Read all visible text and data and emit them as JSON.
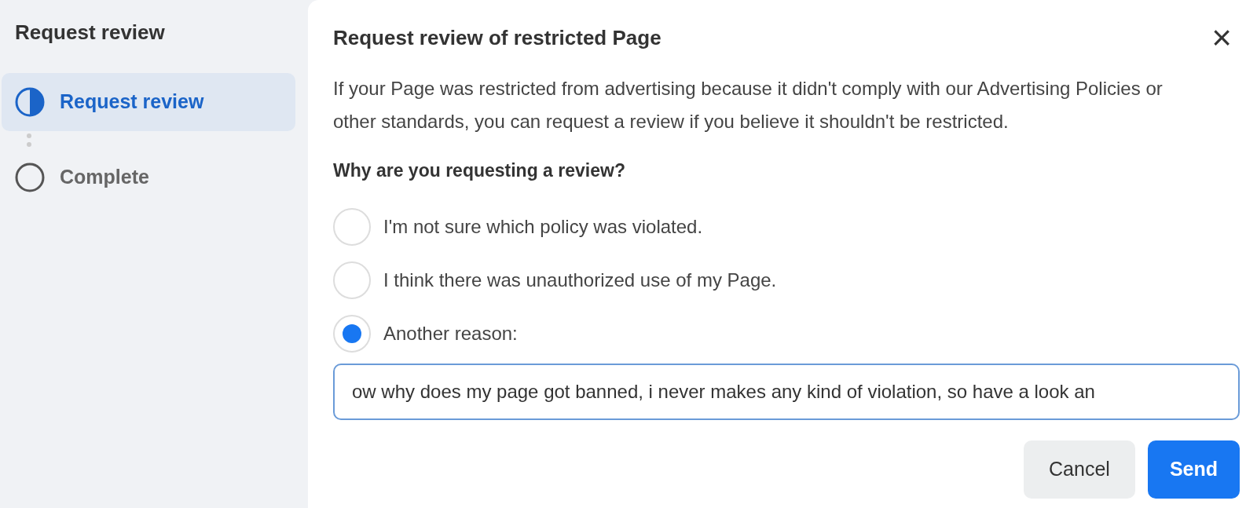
{
  "sidebar": {
    "title": "Request review",
    "steps": [
      {
        "label": "Request review",
        "kind": "partial",
        "selected": true
      },
      {
        "label": "Complete",
        "kind": "empty",
        "selected": false
      }
    ]
  },
  "dialog": {
    "title": "Request review of restricted Page",
    "close": "×",
    "description": "If your Page was restricted from advertising because it didn't comply with our Advertising Policies or other standards, you can request a review if you believe it shouldn't be restricted.",
    "question": "Why are you requesting a review?",
    "options": [
      {
        "label": "I'm not sure which policy was violated.",
        "selected": false
      },
      {
        "label": "I think there was unauthorized use of my Page.",
        "selected": false
      },
      {
        "label": "Another reason:",
        "selected": true
      }
    ],
    "reason_field": {
      "value": "ow why does my page got banned, i never makes any kind of violation, so have a look an"
    },
    "buttons": [
      {
        "label": "Cancel",
        "kind": "secondary"
      },
      {
        "label": "Send",
        "kind": "primary"
      }
    ]
  }
}
